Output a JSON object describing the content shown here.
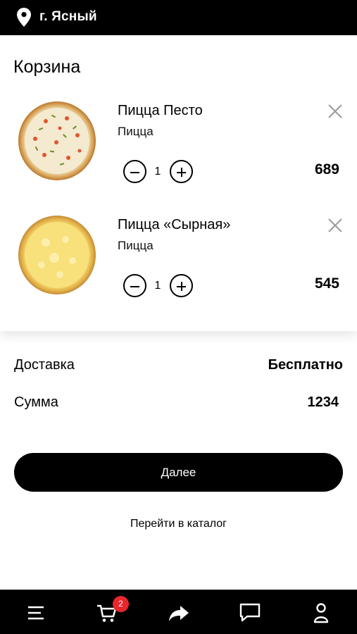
{
  "header": {
    "city": "г. Ясный"
  },
  "cart": {
    "title": "Корзина",
    "items": [
      {
        "name": "Пицца Песто",
        "category": "Пицца",
        "quantity": "1",
        "price": "689"
      },
      {
        "name": "Пицца «Сырная»",
        "category": "Пицца",
        "quantity": "1",
        "price": "545"
      }
    ]
  },
  "summary": {
    "delivery_label": "Доставка",
    "delivery_value": "Бесплатно",
    "total_label": "Сумма",
    "total_value": "1234"
  },
  "actions": {
    "next_label": "Далее",
    "catalog_label": "Перейти в каталог"
  },
  "bottom_nav": {
    "cart_badge": "2",
    "icons": [
      "menu-icon",
      "cart-icon",
      "share-icon",
      "chat-icon",
      "profile-icon"
    ]
  },
  "colors": {
    "bar": "#000000",
    "badge": "#e8262b",
    "background": "#ffffff"
  }
}
